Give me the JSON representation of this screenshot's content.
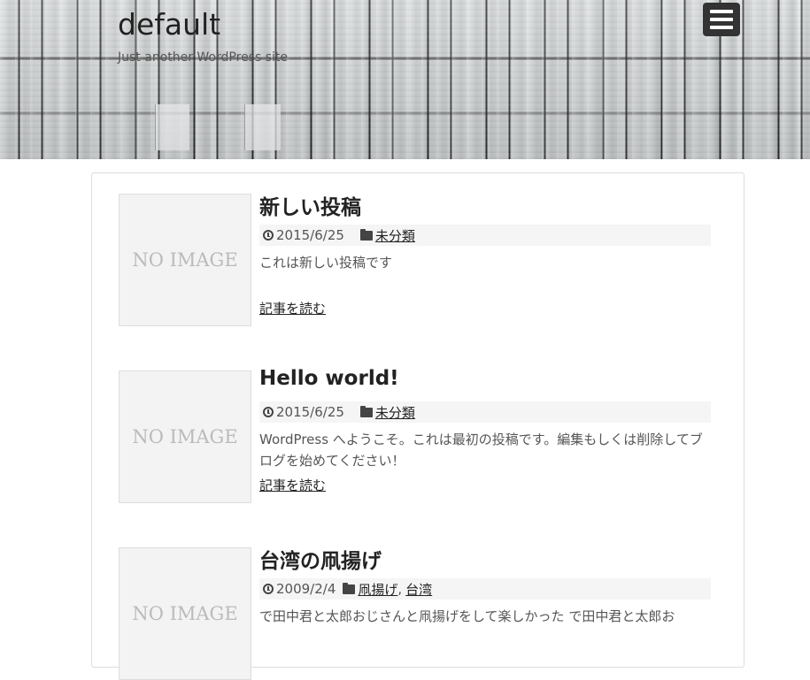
{
  "header": {
    "site_title": "default",
    "site_description": "Just another WordPress site"
  },
  "posts": [
    {
      "thumbnail_text": "NO IMAGE",
      "title": "新しい投稿",
      "date": "2015/6/25",
      "categories": [
        "未分類"
      ],
      "excerpt": "これは新しい投稿です",
      "read_more": "記事を読む"
    },
    {
      "thumbnail_text": "NO IMAGE",
      "title": "Hello world!",
      "date": "2015/6/25",
      "categories": [
        "未分類"
      ],
      "excerpt": "WordPress へようこそ。これは最初の投稿です。編集もしくは削除してブログを始めてください！",
      "read_more": "記事を読む"
    },
    {
      "thumbnail_text": "NO IMAGE",
      "title": "台湾の凧揚げ",
      "date": "2009/2/4",
      "categories": [
        "凧揚げ",
        "台湾"
      ],
      "category_separator": ",",
      "excerpt": "で田中君と太郎おじさんと凧揚げをして楽しかった で田中君と太郎お"
    }
  ]
}
